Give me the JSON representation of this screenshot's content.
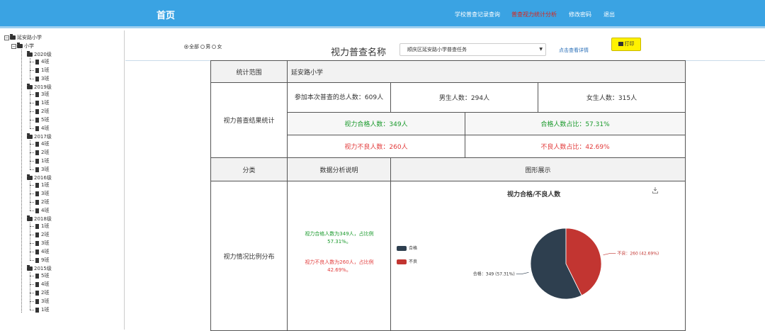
{
  "header": {
    "home": "首页",
    "nav": [
      {
        "label": "学校普查记录查询",
        "active": false
      },
      {
        "label": "普查视力统计分析",
        "active": true
      },
      {
        "label": "修改密码",
        "active": false
      },
      {
        "label": "退出",
        "active": false
      }
    ]
  },
  "sidebar": {
    "root": "延安路小学",
    "level": "小学",
    "grades": [
      {
        "name": "2020级",
        "classes": [
          "4班",
          "1班",
          "3班"
        ]
      },
      {
        "name": "2019级",
        "classes": [
          "3班",
          "1班",
          "2班",
          "5班",
          "4班"
        ]
      },
      {
        "name": "2017级",
        "classes": [
          "4班",
          "2班",
          "1班",
          "3班"
        ]
      },
      {
        "name": "2016级",
        "classes": [
          "1班",
          "3班",
          "2班",
          "4班"
        ]
      },
      {
        "name": "2018级",
        "classes": [
          "1班",
          "2班",
          "3班",
          "4班",
          "9班"
        ]
      },
      {
        "name": "2015级",
        "classes": [
          "5班",
          "4班",
          "2班",
          "3班",
          "1班"
        ]
      }
    ]
  },
  "filters": {
    "gender_options": [
      "全部",
      "男",
      "女"
    ],
    "gender_selected": "全部",
    "survey_label": "视力普查名称",
    "survey_selected": "顺庆区延安路小学普查任务",
    "detail_link": "点击查看详情",
    "print_label": "打印"
  },
  "table": {
    "scope_label": "统计范围",
    "scope_value": "延安路小学",
    "results_label": "视力普查结果统计",
    "total": "参加本次普查的总人数：609人",
    "male": "男生人数：294人",
    "female": "女生人数：315人",
    "pass_count": "视力合格人数：349人",
    "pass_ratio": "合格人数占比：57.31%",
    "fail_count": "视力不良人数：260人",
    "fail_ratio": "不良人数占比：42.69%",
    "col_category": "分类",
    "col_analysis": "数据分析说明",
    "col_chart": "图形展示",
    "row_label": "视力情况比例分布",
    "analysis_pass": "视力合格人数为349人，占比例57.31%。",
    "analysis_fail": "视力不良人数为260人，占比例42.69%。"
  },
  "chart_data": {
    "type": "pie",
    "title": "视力合格/不良人数",
    "legend_position": "left",
    "series": [
      {
        "name": "合格",
        "value": 349,
        "label": "合格：349 (57.31%)",
        "color": "#2e3f4f"
      },
      {
        "name": "不良",
        "value": 260,
        "label": "不良：260 (42.69%)",
        "color": "#c23531"
      }
    ]
  },
  "icons": {
    "download": "download-icon",
    "print": "printer-icon",
    "folder": "folder-icon",
    "file": "file-icon"
  }
}
